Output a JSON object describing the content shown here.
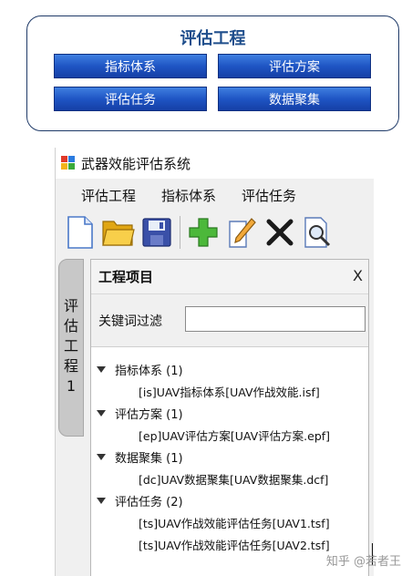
{
  "diagram": {
    "title": "评估工程",
    "buttons": [
      "指标体系",
      "评估方案",
      "评估任务",
      "数据聚集"
    ]
  },
  "window": {
    "title": "武器效能评估系统",
    "menu": [
      "评估工程",
      "指标体系",
      "评估任务"
    ],
    "toolbar_icons": [
      "new-file-icon",
      "open-folder-icon",
      "save-icon",
      "add-icon",
      "edit-icon",
      "delete-icon",
      "search-icon"
    ]
  },
  "side_tab": {
    "chars": [
      "评",
      "估",
      "工",
      "程",
      "1"
    ]
  },
  "panel": {
    "title": "工程项目",
    "close_label": "X",
    "filter_label": "关键词过滤",
    "filter_value": ""
  },
  "tree": [
    {
      "label": "指标体系 (1)",
      "items": [
        "[is]UAV指标体系[UAV作战效能.isf]"
      ]
    },
    {
      "label": "评估方案 (1)",
      "items": [
        "[ep]UAV评估方案[UAV评估方案.epf]"
      ]
    },
    {
      "label": "数据聚集 (1)",
      "items": [
        "[dc]UAV数据聚集[UAV数据聚集.dcf]"
      ]
    },
    {
      "label": "评估任务 (2)",
      "items": [
        "[ts]UAV作战效能评估任务[UAV1.tsf]",
        "[ts]UAV作战效能评估任务[UAV2.tsf]"
      ]
    }
  ],
  "watermark": "知乎 @若者王",
  "colors": {
    "diagram_border": "#1f3a68",
    "button_blue": "#1f55c4",
    "title_blue": "#1f4e8c"
  }
}
